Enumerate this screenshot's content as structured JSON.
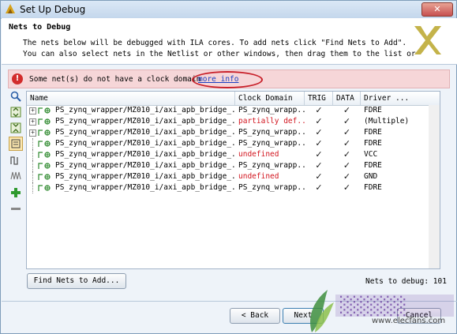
{
  "window": {
    "title": "Set Up Debug"
  },
  "header": {
    "title": "Nets to Debug",
    "description_line1": "The nets below will be debugged with ILA cores. To add nets click \"Find Nets to Add\".",
    "description_line2": "You can also select nets in the Netlist or other windows, then drag them to the list or"
  },
  "warning": {
    "text": "Some net(s) do not have a clock domain",
    "link": "more info",
    "color": "#f6d6d8"
  },
  "toolbar": {
    "icons": [
      "search-icon",
      "collapse-all-icon",
      "expand-all-icon",
      "group-icon",
      "pulse-icon",
      "waveform-icon",
      "add-icon",
      "remove-icon"
    ]
  },
  "table": {
    "columns": [
      "Name",
      "Clock Domain",
      "TRIG",
      "DATA",
      "Driver ..."
    ],
    "rows": [
      {
        "name": "PS_zynq_wrapper/MZ010_i/axi_apb_bridge_...",
        "clock": "PS_zynq_wrapp...",
        "clock_red": false,
        "trig": true,
        "data": true,
        "driver": "FDRE",
        "expandable": true
      },
      {
        "name": "PS_zynq_wrapper/MZ010_i/axi_apb_bridge_...",
        "clock": "partially def...",
        "clock_red": true,
        "trig": true,
        "data": true,
        "driver": "(Multiple)",
        "expandable": true
      },
      {
        "name": "PS_zynq_wrapper/MZ010_i/axi_apb_bridge_...",
        "clock": "PS_zynq_wrapp...",
        "clock_red": false,
        "trig": true,
        "data": true,
        "driver": "FDRE",
        "expandable": true
      },
      {
        "name": "PS_zynq_wrapper/MZ010_i/axi_apb_bridge_...",
        "clock": "PS_zynq_wrapp...",
        "clock_red": false,
        "trig": true,
        "data": true,
        "driver": "FDRE",
        "expandable": false
      },
      {
        "name": "PS_zynq_wrapper/MZ010_i/axi_apb_bridge_...",
        "clock": "undefined",
        "clock_red": true,
        "trig": true,
        "data": true,
        "driver": "VCC",
        "expandable": false
      },
      {
        "name": "PS_zynq_wrapper/MZ010_i/axi_apb_bridge_...",
        "clock": "PS_zynq_wrapp...",
        "clock_red": false,
        "trig": true,
        "data": true,
        "driver": "FDRE",
        "expandable": false
      },
      {
        "name": "PS_zynq_wrapper/MZ010_i/axi_apb_bridge_...",
        "clock": "undefined",
        "clock_red": true,
        "trig": true,
        "data": true,
        "driver": "GND",
        "expandable": false
      },
      {
        "name": "PS_zynq_wrapper/MZ010_i/axi_apb_bridge_...",
        "clock": "PS_zynq_wrapp...",
        "clock_red": false,
        "trig": true,
        "data": true,
        "driver": "FDRE",
        "expandable": false
      }
    ]
  },
  "find_button": {
    "label": "Find Nets to Add..."
  },
  "nets_count": "Nets to debug: 101",
  "footer": {
    "back_label": "< Back",
    "next_label": "Next",
    "cancel_label": "Cancel"
  },
  "watermark": {
    "text": "www.elecfans.com"
  }
}
